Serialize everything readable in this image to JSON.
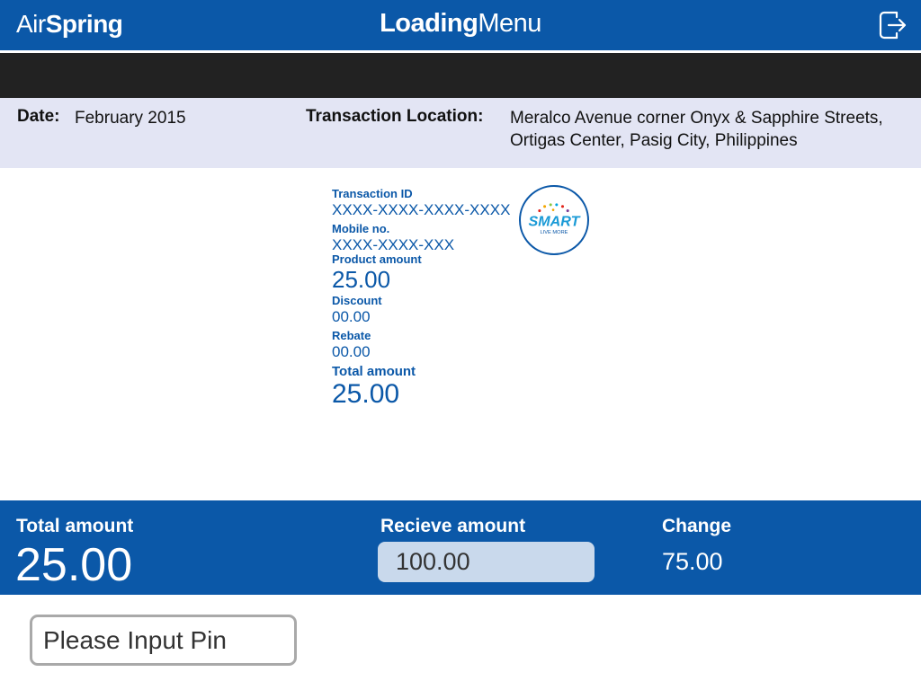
{
  "header": {
    "brand_light": "Air",
    "brand_bold": "Spring",
    "title_bold": "Loading",
    "title_light": "Menu",
    "logout_icon": "logout-icon"
  },
  "info": {
    "date_label": "Date:",
    "date_value": "February 2015",
    "location_label": "Transaction Location:",
    "location_value": "Meralco Avenue corner Onyx & Sapphire Streets, Ortigas Center, Pasig City, Philippines"
  },
  "receipt": {
    "transaction_id_label": "Transaction ID",
    "transaction_id_value": "XXXX-XXXX-XXXX-XXXX",
    "mobile_label": "Mobile no.",
    "mobile_value": "XXXX-XXXX-XXX",
    "product_amount_label": "Product amount",
    "product_amount_value": "25.00",
    "discount_label": "Discount",
    "discount_value": "00.00",
    "rebate_label": "Rebate",
    "rebate_value": "00.00",
    "total_amount_label": "Total amount",
    "total_amount_value": "25.00",
    "logo": {
      "name": "SMART",
      "tagline": "LIVE MORE"
    }
  },
  "totals": {
    "total_label": "Total amount",
    "total_value": "25.00",
    "receive_label": "Recieve amount",
    "receive_value": "100.00",
    "change_label": "Change",
    "change_value": "75.00"
  },
  "pin": {
    "placeholder": "Please Input Pin"
  },
  "colors": {
    "primary_blue": "#0b58a8",
    "info_band": "#e3e5f4",
    "dark_band": "#222222",
    "input_fill": "#c9d9ec"
  }
}
